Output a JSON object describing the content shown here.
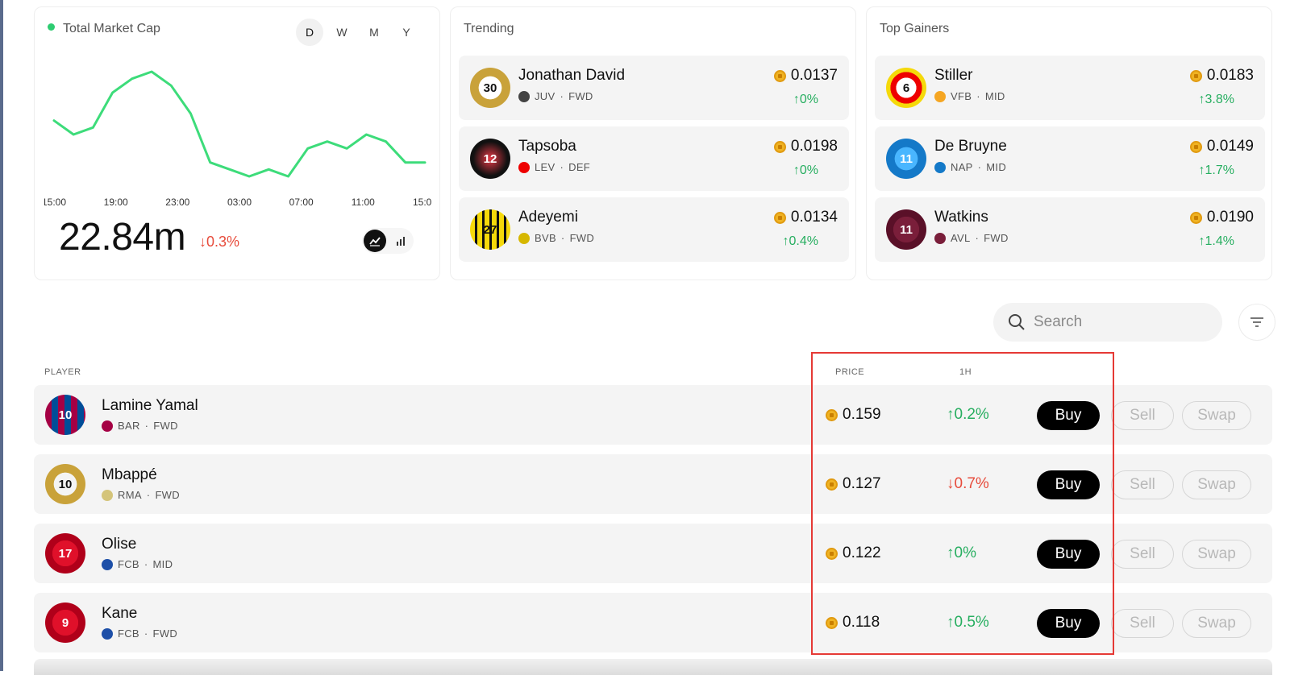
{
  "colors": {
    "green": "#27ae60",
    "red": "#e74c3c",
    "highlight": "#e53935",
    "line": "#3ddc7a"
  },
  "market": {
    "title": "Total Market Cap",
    "range_tabs": [
      "D",
      "W",
      "M",
      "Y"
    ],
    "active_range": "D",
    "value": "22.84m",
    "change": "↓0.3%",
    "toggle_icons": [
      "line-chart-icon",
      "bar-chart-icon"
    ]
  },
  "chart_data": {
    "type": "line",
    "xlabels": [
      "15:00",
      "19:00",
      "23:00",
      "03:00",
      "07:00",
      "11:00",
      "15:00"
    ],
    "values": [
      22.9,
      22.88,
      22.89,
      22.94,
      22.96,
      22.97,
      22.95,
      22.91,
      22.84,
      22.83,
      22.82,
      22.83,
      22.82,
      22.86,
      22.87,
      22.86,
      22.88,
      22.87,
      22.84,
      22.84
    ],
    "grid": false
  },
  "trending": {
    "title": "Trending",
    "items": [
      {
        "name": "Jonathan David",
        "club": "JUV",
        "pos": "FWD",
        "price": "0.0137",
        "change": "↑0%"
      },
      {
        "name": "Tapsoba",
        "club": "LEV",
        "pos": "DEF",
        "price": "0.0198",
        "change": "↑0%"
      },
      {
        "name": "Adeyemi",
        "club": "BVB",
        "pos": "FWD",
        "price": "0.0134",
        "change": "↑0.4%"
      }
    ]
  },
  "gainers": {
    "title": "Top Gainers",
    "items": [
      {
        "name": "Stiller",
        "club": "VFB",
        "pos": "MID",
        "price": "0.0183",
        "change": "↑3.8%"
      },
      {
        "name": "De Bruyne",
        "club": "NAP",
        "pos": "MID",
        "price": "0.0149",
        "change": "↑1.7%"
      },
      {
        "name": "Watkins",
        "club": "AVL",
        "pos": "FWD",
        "price": "0.0190",
        "change": "↑1.4%"
      }
    ]
  },
  "search": {
    "placeholder": "Search"
  },
  "table": {
    "headers": {
      "player": "PLAYER",
      "price": "PRICE",
      "change": "1H"
    },
    "buttons": {
      "buy": "Buy",
      "sell": "Sell",
      "swap": "Swap"
    },
    "rows": [
      {
        "name": "Lamine Yamal",
        "club": "BAR",
        "pos": "FWD",
        "price": "0.159",
        "change": "↑0.2%",
        "dir": "up"
      },
      {
        "name": "Mbappé",
        "club": "RMA",
        "pos": "FWD",
        "price": "0.127",
        "change": "↓0.7%",
        "dir": "down"
      },
      {
        "name": "Olise",
        "club": "FCB",
        "pos": "MID",
        "price": "0.122",
        "change": "↑0%",
        "dir": "up"
      },
      {
        "name": "Kane",
        "club": "FCB",
        "pos": "FWD",
        "price": "0.118",
        "change": "↑0.5%",
        "dir": "up"
      }
    ]
  },
  "jerseys": {
    "trending": [
      "30",
      "12",
      "27"
    ],
    "gainers": [
      "6",
      "11",
      "11"
    ],
    "rows": [
      "10",
      "10",
      "17",
      "9"
    ]
  }
}
